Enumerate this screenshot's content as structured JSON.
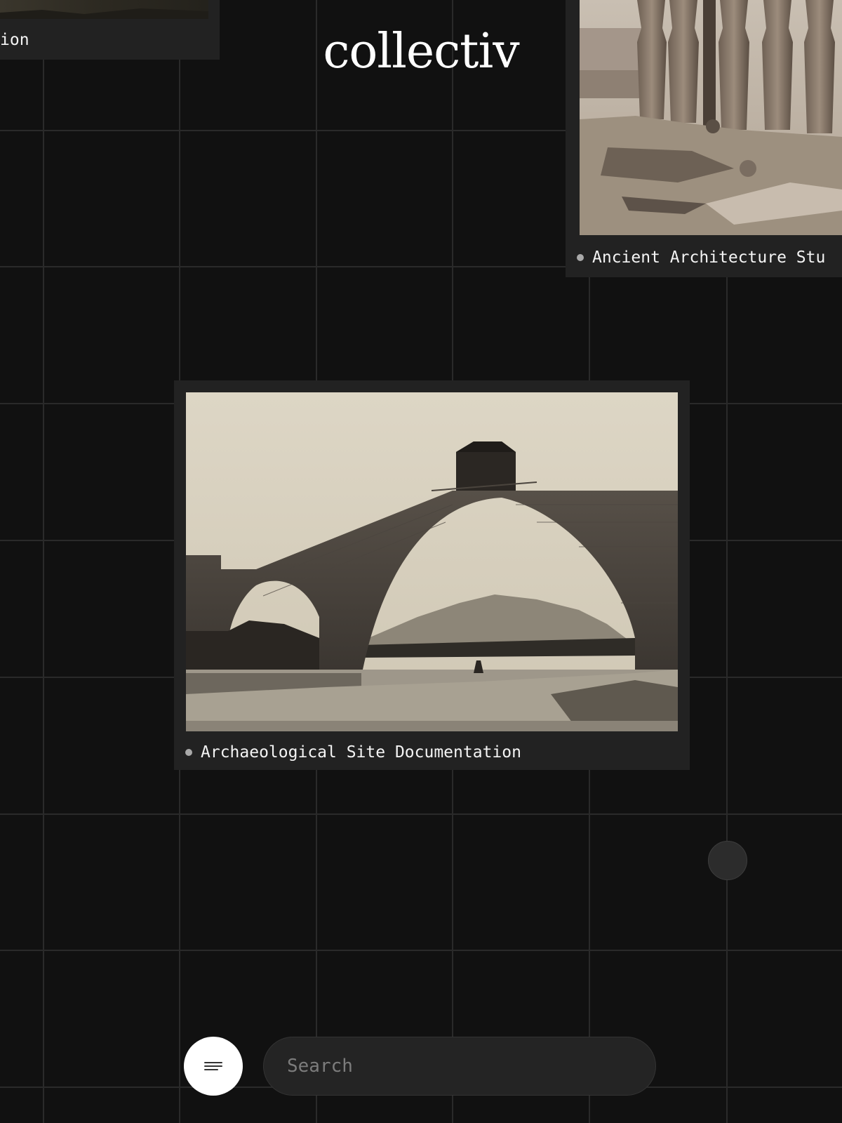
{
  "brand": {
    "logo_text": "collectiv"
  },
  "cards": {
    "top_left": {
      "caption": "ion"
    },
    "top_right": {
      "caption": "Ancient Architecture Stu"
    },
    "main": {
      "caption": "Archaeological Site Documentation"
    }
  },
  "controls": {
    "menu_icon": "menu-lines-icon",
    "search_placeholder": "Search",
    "search_value": ""
  },
  "colors": {
    "background": "#111111",
    "grid_line": "#2a2a2a",
    "card_background": "#222222",
    "caption_dot": "#a9a9a9",
    "menu_button": "#ffffff",
    "search_background": "#242424"
  }
}
